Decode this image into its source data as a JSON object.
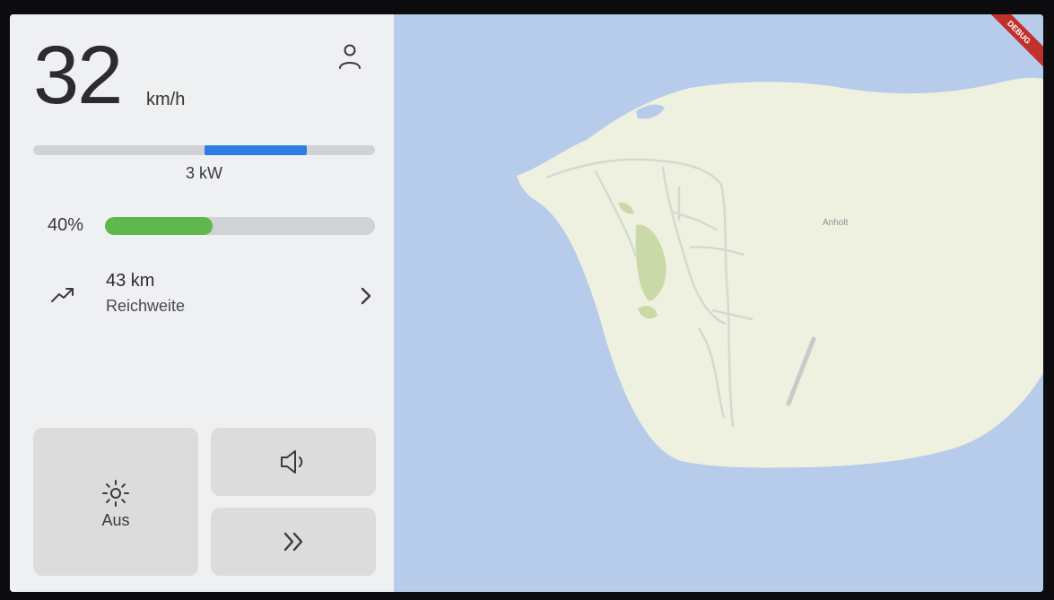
{
  "speed": {
    "value": "32",
    "unit": "km/h"
  },
  "power": {
    "label": "3 kW",
    "fill_start": 0.5,
    "fill_end": 0.8
  },
  "battery": {
    "percent_label": "40%",
    "level": 0.4
  },
  "range": {
    "value": "43 km",
    "label": "Reichweite",
    "icon": "trending-up-icon"
  },
  "controls": {
    "light_label": "Aus",
    "light_icon": "sun-icon",
    "volume_icon": "volume-icon",
    "forward_icon": "double-chevron-right-icon"
  },
  "map": {
    "place_label": "Anholt"
  },
  "debug_banner": "DEBUG",
  "colors": {
    "accent_blue": "#2f7de1",
    "battery_green": "#5fb84c",
    "water": "#b7cbea",
    "land": "#eef1df",
    "park": "#c9d9a8"
  }
}
